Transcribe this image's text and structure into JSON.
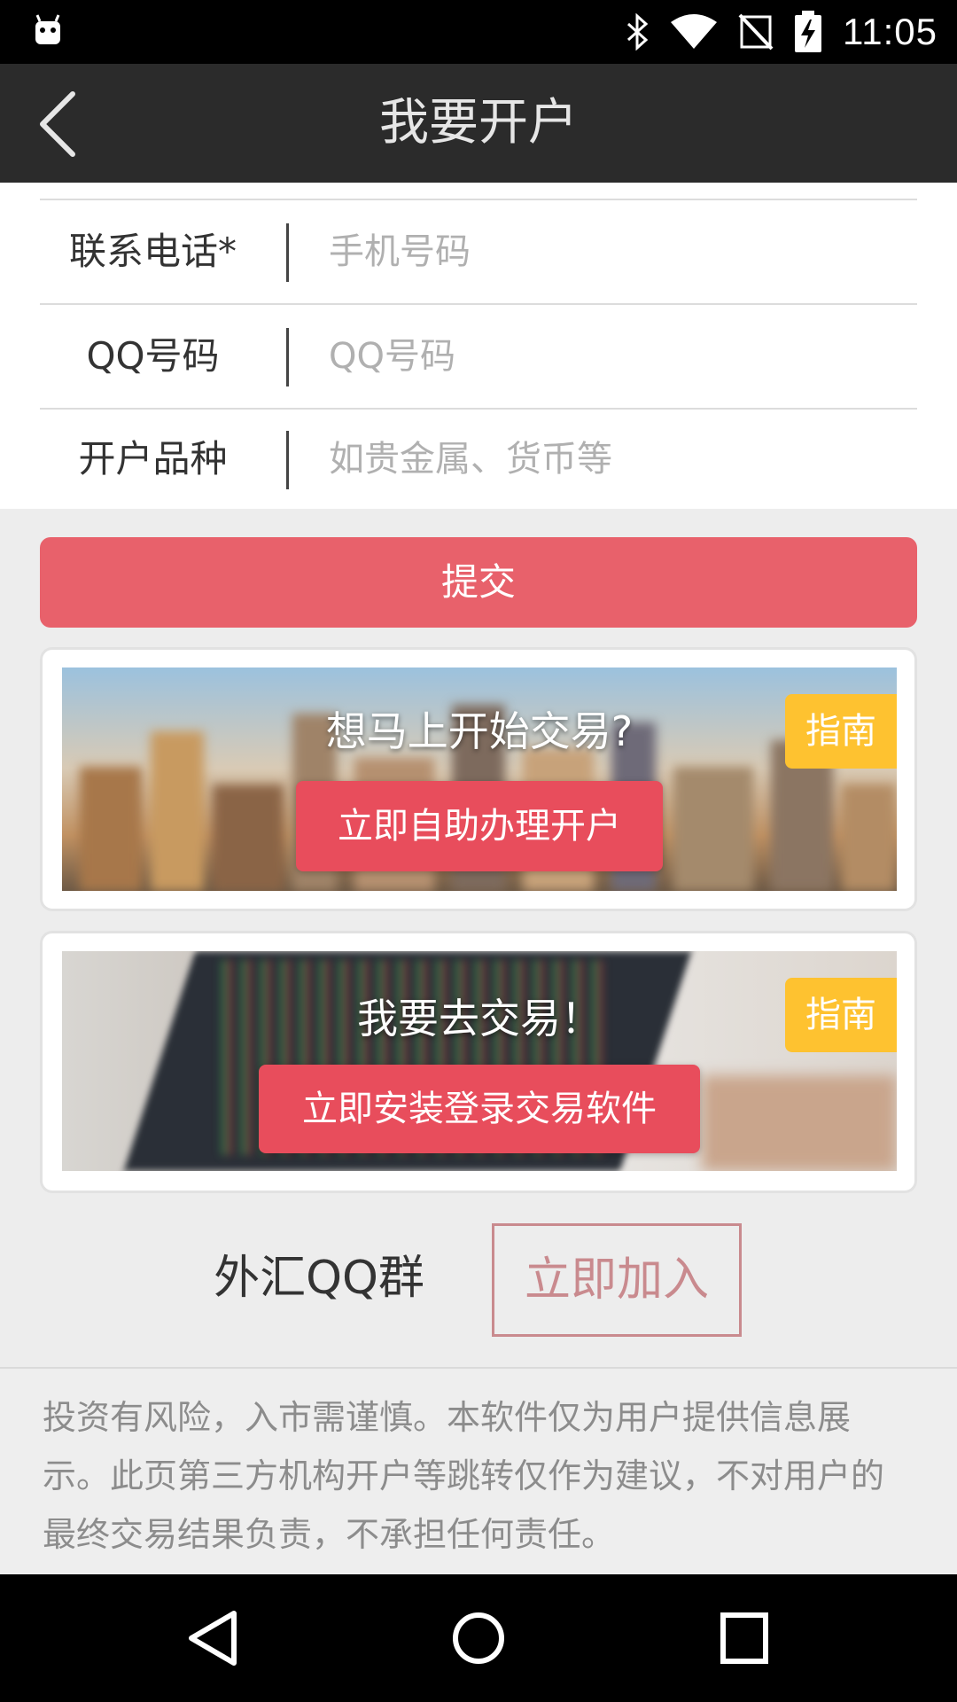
{
  "status_bar": {
    "time": "11:05",
    "icons": [
      "android-icon",
      "bluetooth-icon",
      "wifi-icon",
      "no-sim-icon",
      "battery-charging-icon"
    ]
  },
  "header": {
    "title": "我要开户",
    "back_icon": "chevron-left-icon"
  },
  "form": {
    "fields": [
      {
        "label": "联系电话*",
        "placeholder": "手机号码",
        "value": ""
      },
      {
        "label": "QQ号码",
        "placeholder": "QQ号码",
        "value": ""
      },
      {
        "label": "开户品种",
        "placeholder": "如贵金属、货币等",
        "value": ""
      }
    ],
    "submit_label": "提交"
  },
  "promos": [
    {
      "headline": "想马上开始交易?",
      "cta": "立即自助办理开户",
      "badge": "指南"
    },
    {
      "headline": "我要去交易！",
      "cta": "立即安装登录交易软件",
      "badge": "指南"
    }
  ],
  "qq_group": {
    "label": "外汇QQ群",
    "button": "立即加入"
  },
  "disclaimer": "投资有风险，入市需谨慎。本软件仅为用户提供信息展示。此页第三方机构开户等跳转仅作为建议，不对用户的最终交易结果负责，不承担任何责任。",
  "nav_bar": {
    "icons": [
      "back-triangle-icon",
      "home-circle-icon",
      "recents-square-icon"
    ]
  },
  "colors": {
    "header_bg": "#2b2b2b",
    "accent_red": "#e8616b",
    "cta_red": "#e84d5c",
    "badge_yellow": "#fec230",
    "join_border": "#c98a8e"
  }
}
